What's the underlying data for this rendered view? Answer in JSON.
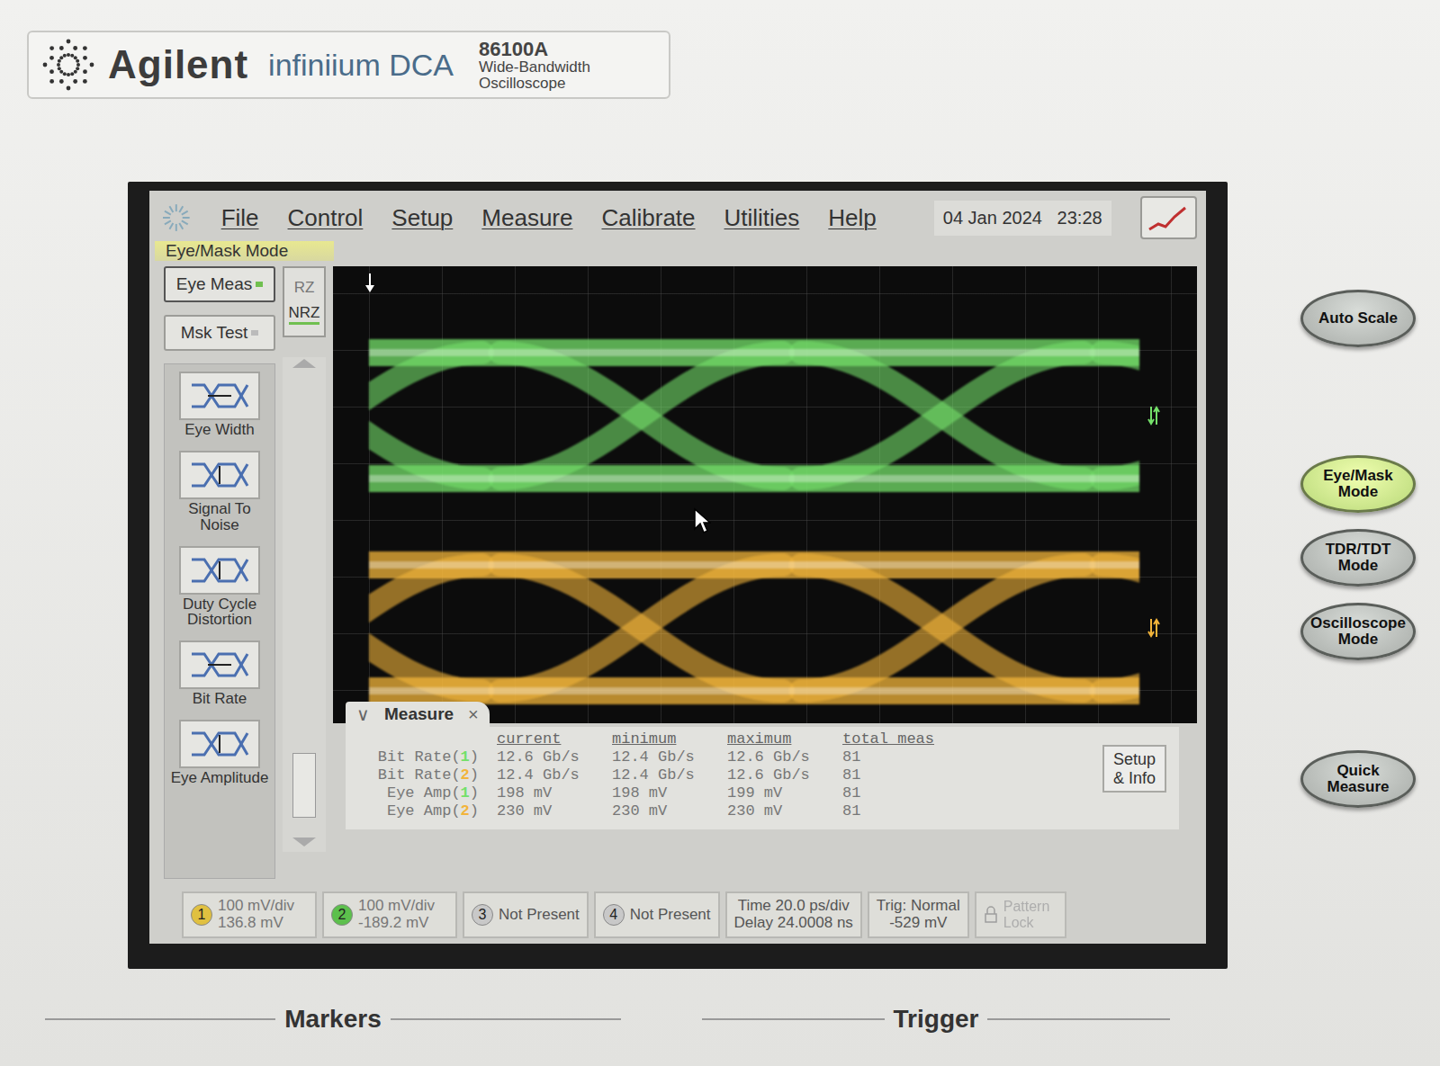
{
  "brand": {
    "logo": "Agilent",
    "product": "infiniium DCA",
    "model": "86100A",
    "subtitle": [
      "Wide-Bandwidth",
      "Oscilloscope"
    ]
  },
  "menu": [
    "File",
    "Control",
    "Setup",
    "Measure",
    "Calibrate",
    "Utilities",
    "Help"
  ],
  "datetime": "04 Jan 2024   23:28",
  "mode_label": "Eye/Mask Mode",
  "toggles": [
    {
      "label": "Eye Meas",
      "on": true
    },
    {
      "label": "Msk Test",
      "on": false
    }
  ],
  "format": [
    {
      "label": "RZ",
      "selected": false
    },
    {
      "label": "NRZ",
      "selected": true
    }
  ],
  "tools": [
    "Eye Width",
    "Signal To Noise",
    "Duty Cycle Distortion",
    "Bit Rate",
    "Eye Amplitude"
  ],
  "traces": [
    {
      "channel": "1",
      "color": "#74e06a"
    },
    {
      "channel": "2",
      "color": "#f2b43a"
    }
  ],
  "measure": {
    "title": "Measure",
    "collapse": "∨",
    "close": "×",
    "columns": [
      "current",
      "minimum",
      "maximum",
      "total meas"
    ],
    "rows": [
      {
        "prefix": "Bit Rate(",
        "channel": "1",
        "suffix": ")",
        "values": [
          "12.6 Gb/s",
          "12.4 Gb/s",
          "12.6 Gb/s",
          "81"
        ]
      },
      {
        "prefix": "Bit Rate(",
        "channel": "2",
        "suffix": ")",
        "values": [
          "12.4 Gb/s",
          "12.4 Gb/s",
          "12.6 Gb/s",
          "81"
        ]
      },
      {
        "prefix": "Eye Amp(",
        "channel": "1",
        "suffix": ")",
        "values": [
          "198 mV",
          "198 mV",
          "199 mV",
          "81"
        ]
      },
      {
        "prefix": "Eye Amp(",
        "channel": "2",
        "suffix": ")",
        "values": [
          "230 mV",
          "230 mV",
          "230 mV",
          "81"
        ]
      }
    ],
    "setup_button": [
      "Setup",
      "& Info"
    ]
  },
  "channels": [
    {
      "num": "1",
      "present": true,
      "lines": [
        "100 mV/div",
        "136.8 mV"
      ],
      "color": "#e0c040"
    },
    {
      "num": "2",
      "present": true,
      "lines": [
        "100 mV/div",
        "-189.2 mV"
      ],
      "color": "#5cc04c"
    },
    {
      "num": "3",
      "present": false,
      "lines": [
        "Not Present"
      ],
      "color": "#c8c8c8"
    },
    {
      "num": "4",
      "present": false,
      "lines": [
        "Not Present"
      ],
      "color": "#c8c8c8"
    }
  ],
  "timebase": [
    "Time 20.0 ps/div",
    "Delay 24.0008 ns"
  ],
  "trigger_info": [
    "Trig: Normal",
    "-529 mV"
  ],
  "pattern_lock": {
    "label": "Pattern Lock",
    "disabled": true
  },
  "hard_buttons": [
    {
      "label": "Auto Scale",
      "lit": false
    },
    {
      "label": "Eye/Mask Mode",
      "lit": true
    },
    {
      "label": "TDR/TDT Mode",
      "lit": false
    },
    {
      "label": "Oscilloscope Mode",
      "lit": false
    },
    {
      "label": "Quick Measure",
      "lit": false
    }
  ],
  "panel_groups": [
    "Markers",
    "Trigger"
  ]
}
